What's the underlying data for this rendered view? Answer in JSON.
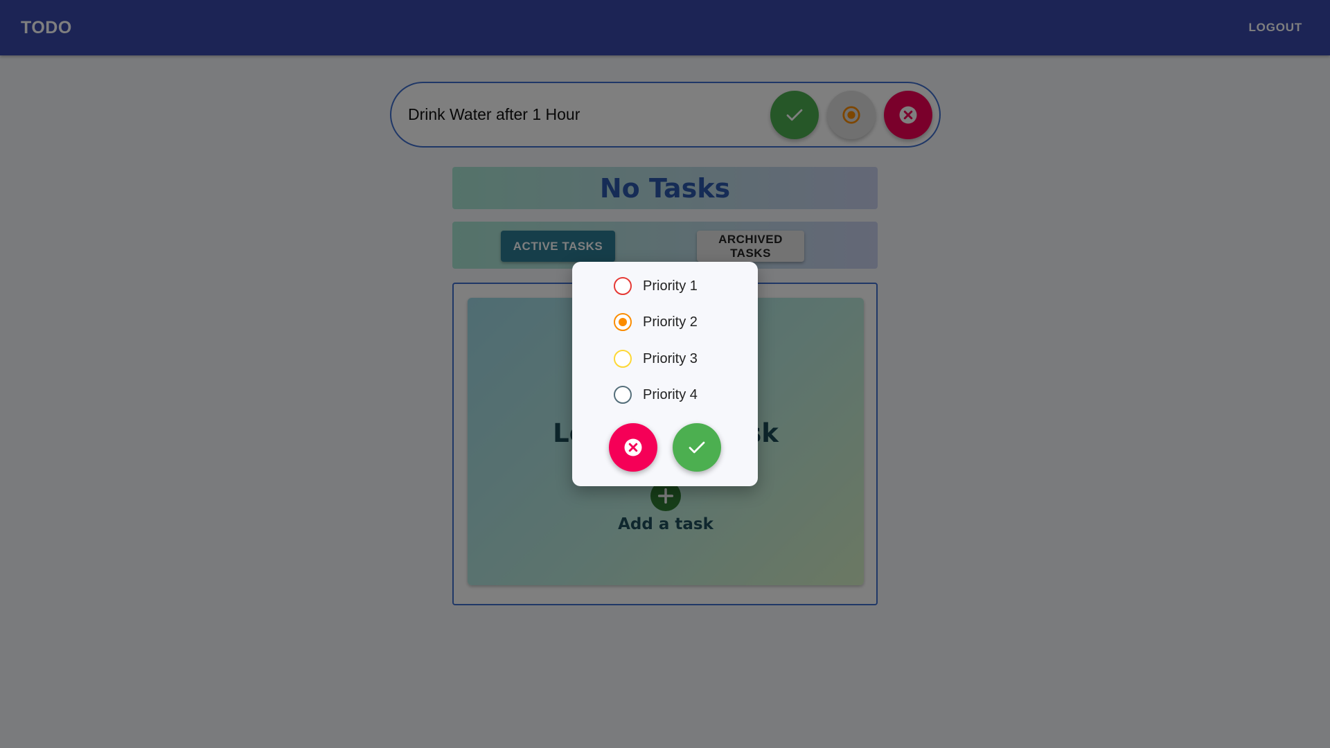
{
  "appbar": {
    "brand": "TODO",
    "logout_label": "LOGOUT",
    "color": "#3949ab"
  },
  "task_input": {
    "value": "Drink Water after 1 Hour",
    "buttons": [
      {
        "icon": "check-icon",
        "color": "#4caf50"
      },
      {
        "icon": "radio-priority-icon",
        "color": "#e0e0e0"
      },
      {
        "icon": "cancel-icon",
        "color": "#f50057"
      }
    ]
  },
  "banner": {
    "title": "No Tasks"
  },
  "tabs": {
    "active_label": "ACTIVE TASKS",
    "archived_label": "ARCHIVED TASKS",
    "selected": "active"
  },
  "empty_state": {
    "heading": "Lets Add a Task",
    "add_label": "Add a task",
    "add_icon": "plus-icon"
  },
  "priority_dialog": {
    "options": [
      {
        "label": "Priority 1",
        "color": "#e53935",
        "selected": false
      },
      {
        "label": "Priority 2",
        "color": "#fb8c00",
        "selected": true
      },
      {
        "label": "Priority 3",
        "color": "#fdd835",
        "selected": false
      },
      {
        "label": "Priority 4",
        "color": "#546e7a",
        "selected": false
      }
    ],
    "cancel_icon": "cancel-icon",
    "confirm_icon": "check-icon"
  }
}
